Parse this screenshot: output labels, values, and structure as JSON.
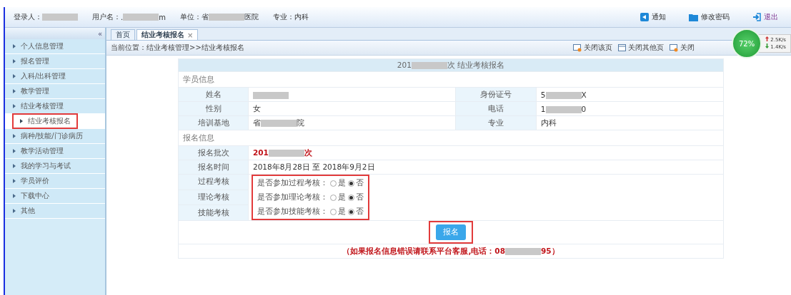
{
  "header": {
    "fields": [
      {
        "label": "登录人：",
        "value": [
          {
            "kind": "redaction"
          }
        ]
      },
      {
        "label": "用户名：",
        "value": [
          {
            "kind": "text",
            "text": "."
          },
          {
            "kind": "redaction"
          },
          {
            "kind": "text",
            "text": "m"
          }
        ]
      },
      {
        "label": "单位：",
        "value": [
          {
            "kind": "text",
            "text": "省"
          },
          {
            "kind": "redaction"
          },
          {
            "kind": "text",
            "text": "医院"
          }
        ]
      },
      {
        "label": "专业：",
        "value": [
          {
            "kind": "text",
            "text": "内科"
          }
        ]
      }
    ],
    "actions": [
      {
        "kind": "notice",
        "label": "通知"
      },
      {
        "kind": "password",
        "label": "修改密码"
      },
      {
        "kind": "logout",
        "label": "退出"
      }
    ]
  },
  "sidebar": {
    "collapse": "«",
    "items": [
      {
        "label": "个人信息管理",
        "selected": false
      },
      {
        "label": "报名管理",
        "selected": false
      },
      {
        "label": "入科/出科管理",
        "selected": false
      },
      {
        "label": "教学管理",
        "selected": false
      },
      {
        "label": "结业考核管理",
        "selected": false,
        "children": [
          {
            "label": "结业考核报名",
            "selected": true,
            "highlighted": true
          }
        ]
      },
      {
        "label": "病种/技能/门诊病历",
        "selected": false
      },
      {
        "label": "教学活动管理",
        "selected": false
      },
      {
        "label": "我的学习与考试",
        "selected": false
      },
      {
        "label": "学员评价",
        "selected": false
      },
      {
        "label": "下载中心",
        "selected": false
      },
      {
        "label": "其他",
        "selected": false
      }
    ]
  },
  "tabs": [
    {
      "label": "首页",
      "selected": false,
      "closable": false
    },
    {
      "label": "结业考核报名",
      "selected": true,
      "closable": true,
      "close": "×"
    }
  ],
  "breadcrumb": "当前位置：结业考核管理>>结业考核报名",
  "page_actions": [
    {
      "kind": "close-page",
      "label": "关闭该页"
    },
    {
      "kind": "close-others",
      "label": "关闭其他页"
    },
    {
      "kind": "close-page",
      "label": "关闭"
    }
  ],
  "form": {
    "title": [
      {
        "kind": "text",
        "text": "201"
      },
      {
        "kind": "redaction"
      },
      {
        "kind": "text",
        "text": "次 结业考核报名"
      }
    ],
    "sections": [
      {
        "heading": "学员信息",
        "rows": [
          {
            "kind": "pair",
            "cells": [
              {
                "label": "姓名",
                "value": [
                  {
                    "kind": "redaction"
                  }
                ]
              },
              {
                "label": "身份证号",
                "value": [
                  {
                    "kind": "text",
                    "text": "5"
                  },
                  {
                    "kind": "redaction"
                  },
                  {
                    "kind": "text",
                    "text": "X"
                  }
                ]
              }
            ]
          },
          {
            "kind": "pair",
            "cells": [
              {
                "label": "性别",
                "value": [
                  {
                    "kind": "text",
                    "text": "女"
                  }
                ]
              },
              {
                "label": "电话",
                "value": [
                  {
                    "kind": "text",
                    "text": "1"
                  },
                  {
                    "kind": "redaction"
                  },
                  {
                    "kind": "text",
                    "text": "0"
                  }
                ]
              }
            ]
          },
          {
            "kind": "pair",
            "cells": [
              {
                "label": "培训基地",
                "value": [
                  {
                    "kind": "text",
                    "text": "省"
                  },
                  {
                    "kind": "redaction"
                  },
                  {
                    "kind": "text",
                    "text": "院"
                  }
                ]
              },
              {
                "label": "专业",
                "value": [
                  {
                    "kind": "text",
                    "text": "内科"
                  }
                ]
              }
            ]
          }
        ]
      },
      {
        "heading": "报名信息",
        "rows": [
          {
            "kind": "single",
            "label": "报名批次",
            "emphasis": true,
            "value": [
              {
                "kind": "text",
                "text": "201"
              },
              {
                "kind": "redaction"
              },
              {
                "kind": "text",
                "text": "次"
              }
            ]
          },
          {
            "kind": "single",
            "label": "报名时间",
            "emphasis": false,
            "value": [
              {
                "kind": "text",
                "text": "2018年8月28日 至 2018年9月2日"
              }
            ]
          },
          {
            "kind": "radio",
            "label": "过程考核",
            "question": "是否参加过程考核：",
            "options": [
              {
                "label": "是",
                "selected": false
              },
              {
                "label": "否",
                "selected": true
              }
            ]
          },
          {
            "kind": "radio",
            "label": "理论考核",
            "question": "是否参加理论考核：",
            "options": [
              {
                "label": "是",
                "selected": false
              },
              {
                "label": "否",
                "selected": true
              }
            ]
          },
          {
            "kind": "radio",
            "label": "技能考核",
            "question": "是否参加技能考核：",
            "options": [
              {
                "label": "是",
                "selected": false
              },
              {
                "label": "否",
                "selected": true
              }
            ]
          }
        ]
      }
    ],
    "radios_highlighted": true,
    "submit": {
      "label": "报名",
      "highlighted": true
    },
    "note": [
      {
        "kind": "text",
        "text": "（如果报名信息错误请联系平台客服,电话：08"
      },
      {
        "kind": "redaction"
      },
      {
        "kind": "text",
        "text": "95）"
      }
    ]
  },
  "speed_widget": {
    "percent": "72%",
    "up": "2.5K/s",
    "down": "1.4K/s"
  }
}
